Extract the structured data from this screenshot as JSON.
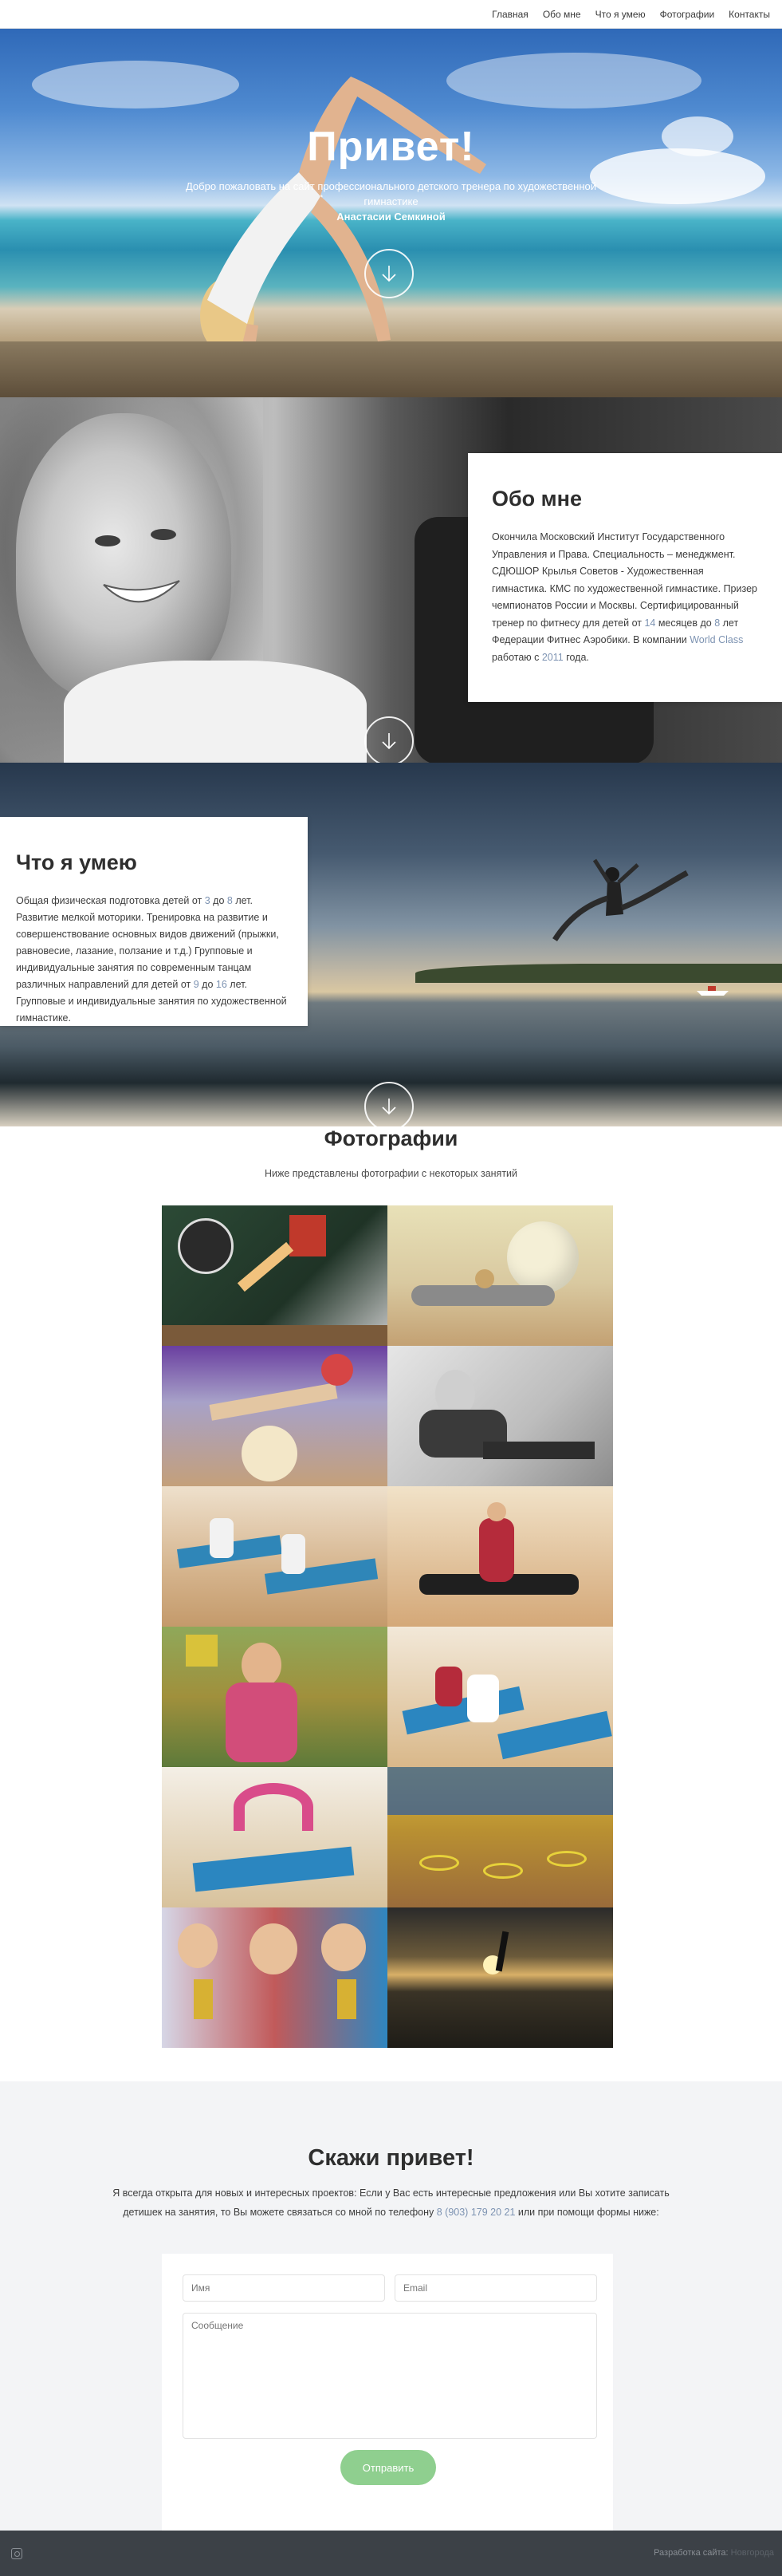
{
  "nav": {
    "items": [
      {
        "label": "Главная"
      },
      {
        "label": "Обо мне"
      },
      {
        "label": "Что я умею"
      },
      {
        "label": "Фотографии"
      },
      {
        "label": "Контакты"
      }
    ]
  },
  "hero": {
    "title": "Привет!",
    "subtitle": "Добро пожаловать на сайт профессионального детского тренера по художественной гимнастике",
    "name": "Анастасии Семкиной",
    "scroll_icon": "arrow-down-icon"
  },
  "about": {
    "title": "Обо мне",
    "text_a": "Окончила Московский Институт Государственного Управления и Права. Специальность – менеджмент. СДЮШОР Крылья Советов - Художественная гимнастика. КМС по художественной гимнастике. Призер чемпионатов России и Москвы. Сертифицированный тренер по фитнесу для детей от ",
    "num1": "14",
    "text_b": " месяцев до ",
    "num2": "8",
    "text_c": " лет Федерации Фитнес Аэробики. В компании ",
    "brand": "World Class",
    "text_d": " работаю с ",
    "year": "2011",
    "text_e": " года."
  },
  "skills": {
    "title": "Что я умею",
    "text_a": "Общая физическая подготовка детей от ",
    "num1": "3",
    "text_b": " до ",
    "num2": "8",
    "text_c": " лет. Развитие мелкой моторики. Тренировка на развитие и совершенствование основных видов движений (прыжки, равновесие, лазание, ползание и т.д.) Групповые и индивидуальные занятия по современным танцам различных направлений для детей от ",
    "num3": "9",
    "text_d": " до ",
    "num4": "16",
    "text_e": " лет. Групповые и индивидуальные занятия по художественной гимнастике."
  },
  "gallery": {
    "title": "Фотографии",
    "subtitle": "Ниже представлены фотографии с некоторых занятий",
    "photos": [
      {
        "name": "photo-gymnast-cartwheel"
      },
      {
        "name": "photo-ball-stretch"
      },
      {
        "name": "photo-ball-balance"
      },
      {
        "name": "photo-trainer-sitting"
      },
      {
        "name": "photo-kids-mats"
      },
      {
        "name": "photo-split-girl"
      },
      {
        "name": "photo-trainer-kids"
      },
      {
        "name": "photo-kids-split-mats"
      },
      {
        "name": "photo-bridge-pose"
      },
      {
        "name": "photo-hoops-hall"
      },
      {
        "name": "photo-trophies"
      },
      {
        "name": "photo-sunset-reflection"
      }
    ]
  },
  "contact": {
    "title": "Скажи привет!",
    "text_a": "Я всегда открыта для новых и интересных проектов: Если у Вас есть интересные предложения или Вы хотите записать детишек на занятия, то Вы можете связаться со мной по телефону ",
    "phone": "8 (903) 179 20 21",
    "text_b": " или при помощи формы ниже:",
    "name_placeholder": "Имя",
    "email_placeholder": "Email",
    "message_placeholder": "Сообщение",
    "send_label": "Отправить"
  },
  "footer": {
    "icon": "instagram-icon",
    "dev_label": "Разработка сайта:",
    "dev_link": "Новгорода"
  },
  "colors": {
    "accent_green": "#8fcf8f",
    "footer_bg": "#3c4147",
    "highlight": "#7d93b2"
  }
}
